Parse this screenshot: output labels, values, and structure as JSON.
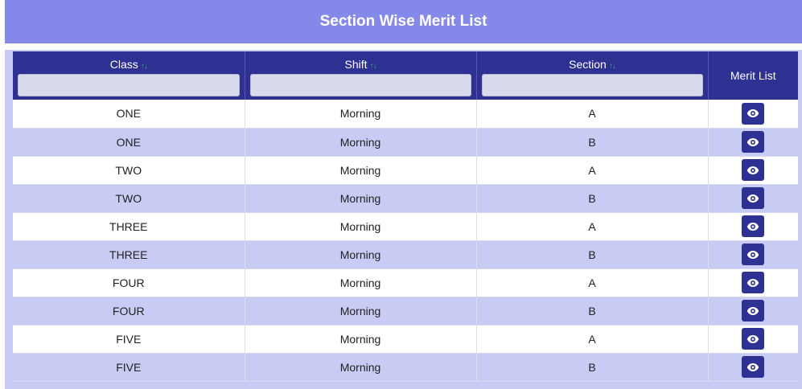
{
  "header": {
    "title": "Section Wise Merit List"
  },
  "table": {
    "columns": [
      {
        "label": "Class",
        "sortable": true
      },
      {
        "label": "Shift",
        "sortable": true
      },
      {
        "label": "Section",
        "sortable": true
      },
      {
        "label": "Merit List",
        "sortable": false
      }
    ],
    "sort_icon": "↑↓",
    "action_icon": "eye-icon",
    "rows": [
      {
        "class": "ONE",
        "shift": "Morning",
        "section": "A"
      },
      {
        "class": "ONE",
        "shift": "Morning",
        "section": "B"
      },
      {
        "class": "TWO",
        "shift": "Morning",
        "section": "A"
      },
      {
        "class": "TWO",
        "shift": "Morning",
        "section": "B"
      },
      {
        "class": "THREE",
        "shift": "Morning",
        "section": "A"
      },
      {
        "class": "THREE",
        "shift": "Morning",
        "section": "B"
      },
      {
        "class": "FOUR",
        "shift": "Morning",
        "section": "A"
      },
      {
        "class": "FOUR",
        "shift": "Morning",
        "section": "B"
      },
      {
        "class": "FIVE",
        "shift": "Morning",
        "section": "A"
      },
      {
        "class": "FIVE",
        "shift": "Morning",
        "section": "B"
      }
    ]
  },
  "colors": {
    "header_bg": "#8488e8",
    "table_head_bg": "#2e3192",
    "row_alt_bg": "#c8cbf4",
    "sort_icon": "#3aa36a"
  }
}
